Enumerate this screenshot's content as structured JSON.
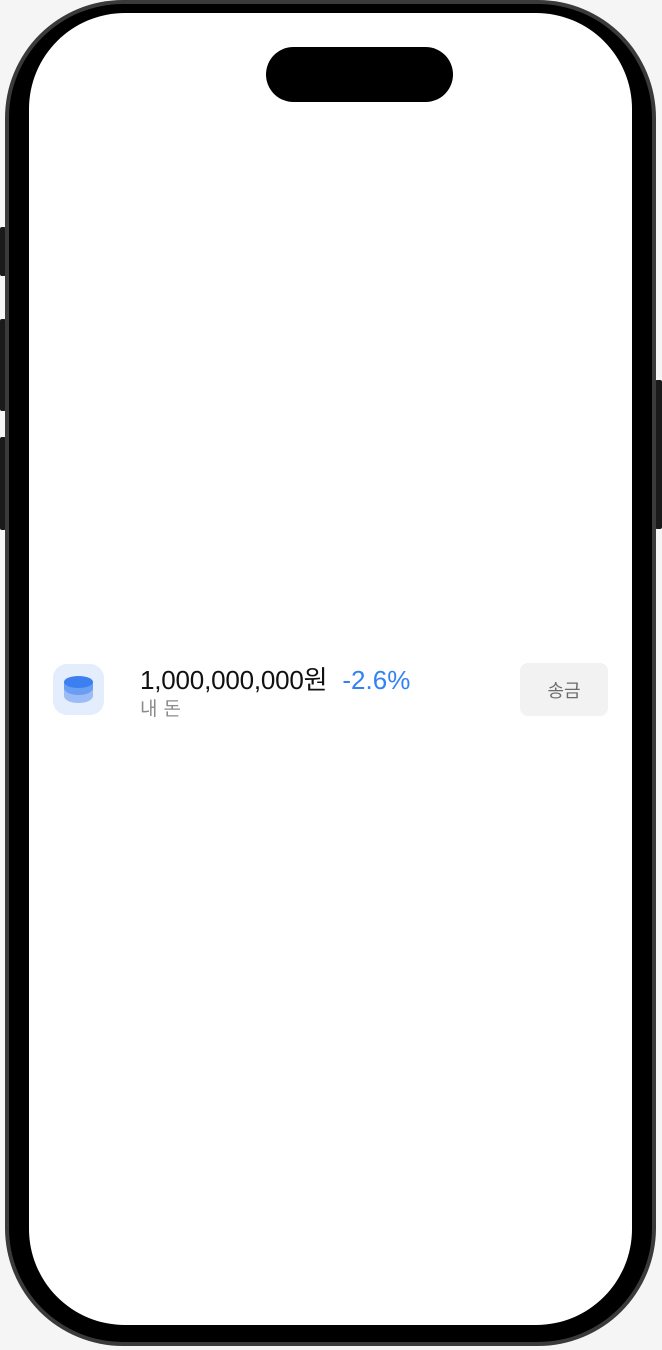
{
  "asset": {
    "amount": "1,000,000,000원",
    "rate": "-2.6%",
    "label": "내 돈",
    "icon": "coin-stack-icon",
    "send_label": "송금"
  },
  "colors": {
    "accent": "#3182f6",
    "icon_bg": "#e3edfc",
    "button_bg": "#f2f2f2",
    "secondary_text": "#8b8b8b"
  }
}
